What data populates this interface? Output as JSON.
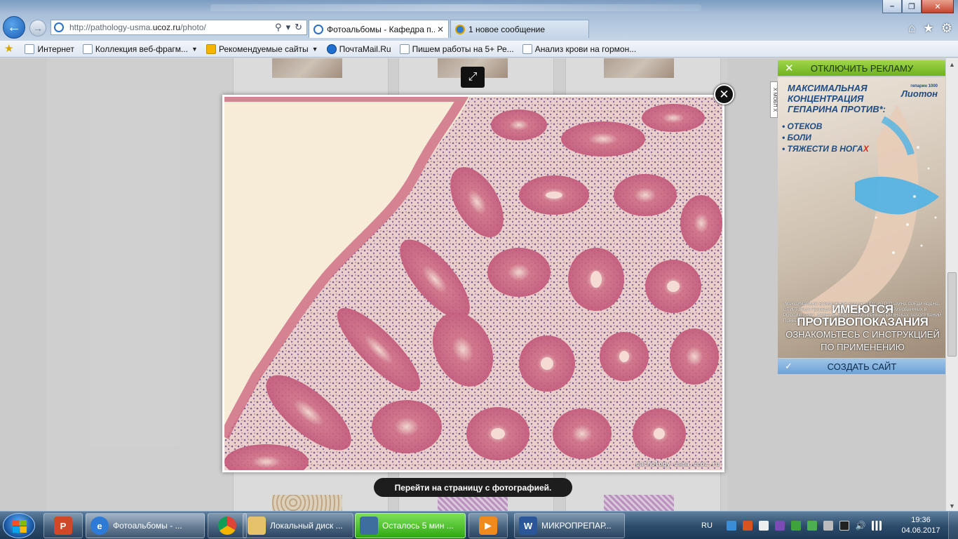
{
  "browser": {
    "url_prefix": "http://pathology-usma.",
    "url_domain": "ucoz.ru",
    "url_suffix": "/photo/",
    "tabs": [
      {
        "label": "Фотоальбомы - Кафедра п...",
        "active": true
      },
      {
        "label": "1 новое сообщение",
        "active": false
      }
    ],
    "window_controls": [
      "–",
      "❐",
      "✕"
    ],
    "top_icons": [
      "home-icon",
      "star-icon",
      "gear-icon"
    ]
  },
  "favorites": {
    "items": [
      {
        "label": "Интернет",
        "icon": "ie-icon"
      },
      {
        "label": "Коллекция веб-фрагм...",
        "icon": "ie-icon",
        "dropdown": true
      },
      {
        "label": "Рекомендуемые сайты",
        "icon": "bing-icon",
        "dropdown": true
      },
      {
        "label": "ПочтаMail.Ru",
        "icon": "mail-icon"
      },
      {
        "label": "Пишем работы на 5+  Ре...",
        "icon": "ie-icon"
      },
      {
        "label": "Анализ крови на гормон...",
        "icon": "ie-icon"
      }
    ]
  },
  "lightbox": {
    "watermark": "pathology-usma.ucoz.ru",
    "goto_label": "Перейти на страницу с фотографией."
  },
  "ad": {
    "off_label": "ОТКЛЮЧИТЬ РЕКЛАМУ",
    "side_label": "Х МОБП Х",
    "headline_lines": [
      "МАКСИМАЛЬНАЯ",
      "КОНЦЕНТРАЦИЯ",
      "ГЕПАРИНА ПРОТИВ*:"
    ],
    "brand": "Лиотон",
    "brand_small": "гепарин 1000",
    "bullets": [
      "ОТЕКОВ",
      "БОЛИ",
      "ТЯЖЕСТИ В НОГА"
    ],
    "bullet_red": "Х",
    "fine_print": "*МАКСИМАЛЬНО ВОЗМОЖНАЯ КОНЦЕНТРАЦИЯ ГЕПАРИНА СРЕДИ ВОДНО-СПИРТОВЫХ ГЕЛЕВЫХ ФОРМ ГЕПАРИНА, ЗАРЕГИСТРИРОВАННЫХ В РОССИИ (ГРЛС, ФЕВРАЛЬ 2016). **ПРИ ПЕРВЫХ ПРИЗНАКАХ ЗАБОЛЕВАНИЙ ПОВЕРХНОСТНЫХ ВЕН",
    "warning_1": "ИМЕЮТСЯ ПРОТИВОПОКАЗАНИЯ",
    "warning_2": "ОЗНАКОМЬТЕСЬ С ИНСТРУКЦИЕЙ ПО ПРИМЕНЕНИЮ",
    "create_label": "СОЗДАТЬ САЙТ"
  },
  "taskbar": {
    "buttons": [
      {
        "label": "Фотоальбомы - ...",
        "icon": "ie-icon"
      },
      {
        "label": "Локальный диск ...",
        "icon": "folder-icon"
      },
      {
        "label": "Осталось 5 мин ...",
        "icon": "copy-icon"
      },
      {
        "label": "МИКРОПРЕПАР...",
        "icon": "word-icon"
      }
    ],
    "lang": "RU",
    "time": "19:36",
    "date": "04.06.2017"
  }
}
